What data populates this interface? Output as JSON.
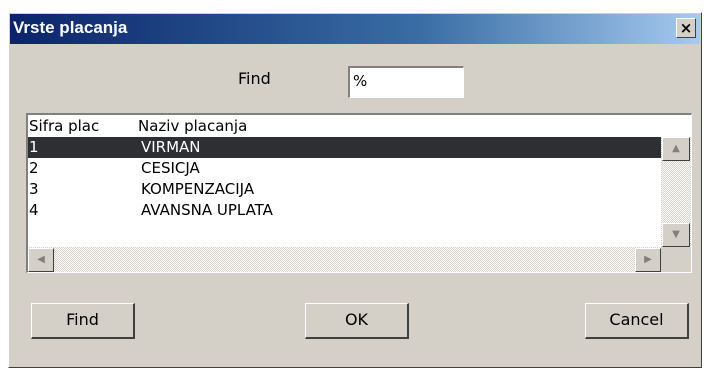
{
  "window": {
    "title": "Vrste placanja",
    "close_label": "×"
  },
  "search": {
    "label": "Find",
    "value": "%"
  },
  "table": {
    "columns": [
      "Sifra plac",
      "Naziv placanja"
    ],
    "rows": [
      {
        "code": "1",
        "name": "VIRMAN",
        "selected": true
      },
      {
        "code": "2",
        "name": "CESICJA",
        "selected": false
      },
      {
        "code": "3",
        "name": "KOMPENZACIJA",
        "selected": false
      },
      {
        "code": "4",
        "name": "AVANSNA UPLATA",
        "selected": false
      }
    ]
  },
  "buttons": {
    "find": "Find",
    "ok": "OK",
    "cancel": "Cancel"
  },
  "icons": {
    "scroll_up": "triangle-up-icon",
    "scroll_down": "triangle-down-icon",
    "scroll_left": "triangle-left-icon",
    "scroll_right": "triangle-right-icon"
  },
  "colors": {
    "titlebar_start": "#0a246a",
    "titlebar_end": "#a6caf0",
    "dialog_bg": "#d4d0c8",
    "selected_row": "#2d2f33"
  }
}
